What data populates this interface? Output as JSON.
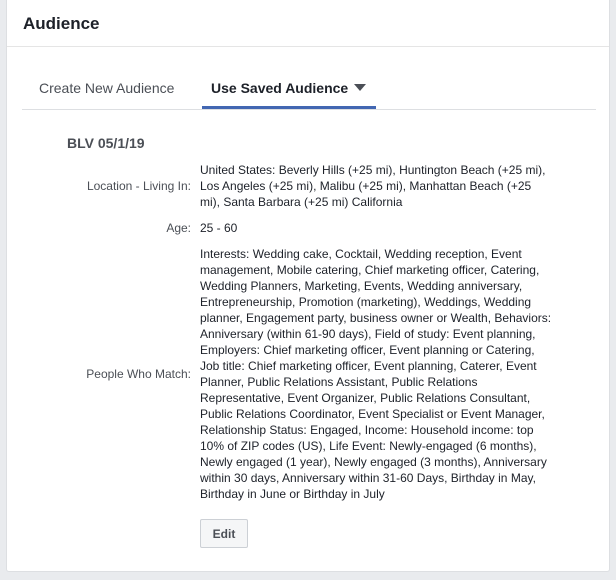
{
  "header": {
    "title": "Audience"
  },
  "tabs": {
    "create_label": "Create New Audience",
    "saved_label": "Use Saved Audience"
  },
  "audience": {
    "name": "BLV 05/1/19",
    "location_label": "Location - Living In:",
    "location_lines": [
      "United States: Beverly Hills (+25 mi), Huntington Beach (+25 mi),",
      "Los Angeles (+25 mi), Malibu (+25 mi), Manhattan Beach (+25",
      "mi), Santa Barbara (+25 mi) California"
    ],
    "age_label": "Age:",
    "age_value": "25 - 60",
    "people_label": "People Who Match:",
    "people_lines": [
      "Interests: Wedding cake, Cocktail, Wedding reception, Event",
      "management, Mobile catering, Chief marketing officer, Catering,",
      "Wedding Planners, Marketing, Events, Wedding anniversary,",
      "Entrepreneurship, Promotion (marketing), Weddings, Wedding",
      "planner, Engagement party, business owner or Wealth, Behaviors:",
      "Anniversary (within 61-90 days), Field of study: Event planning,",
      "Employers: Chief marketing officer, Event planning or Catering,",
      "Job title: Chief marketing officer, Event planning, Caterer, Event",
      "Planner, Public Relations Assistant, Public Relations",
      "Representative, Event Organizer, Public Relations Consultant,",
      "Public Relations Coordinator, Event Specialist or Event Manager,",
      "Relationship Status: Engaged, Income: Household income: top",
      "10% of ZIP codes (US), Life Event: Newly-engaged (6 months),",
      "Newly engaged (1 year), Newly engaged (3 months), Anniversary",
      "within 30 days, Anniversary within 31-60 Days, Birthday in May,",
      "Birthday in June or Birthday in July"
    ]
  },
  "actions": {
    "edit_label": "Edit"
  },
  "colors": {
    "accent": "#4267b2",
    "background": "#e9ebee",
    "text": "#1d2129",
    "muted": "#4b4f56"
  }
}
